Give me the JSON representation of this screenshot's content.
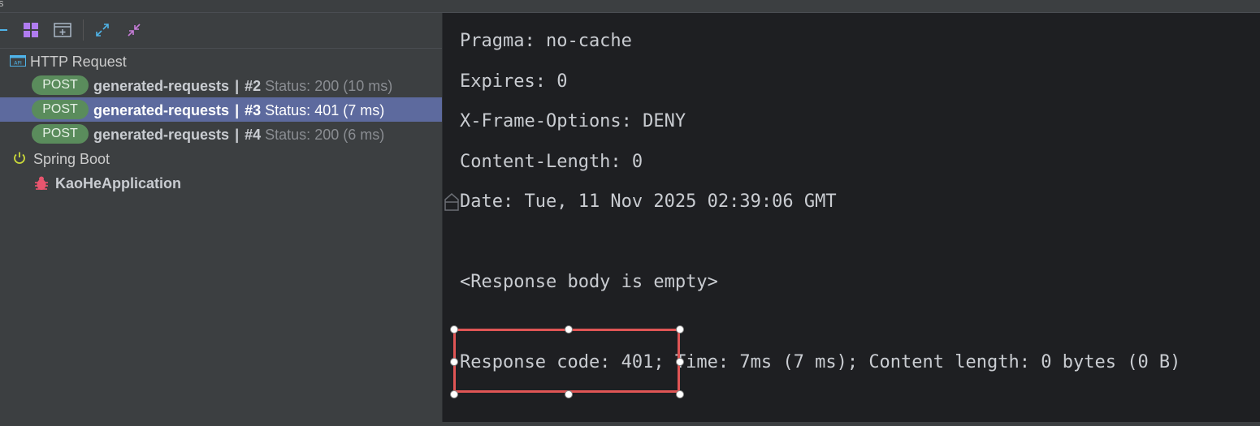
{
  "topbar": {
    "fragment": "s"
  },
  "toolbar": {
    "icons": [
      "minus-icon",
      "layout-grid-icon",
      "add-panel-icon",
      "expand-icon",
      "collapse-icon"
    ]
  },
  "tree": {
    "http_group": "HTTP Request",
    "requests": [
      {
        "method": "POST",
        "name": "generated-requests",
        "separator": "|",
        "number": "#2",
        "status": "Status: 200 (10 ms)"
      },
      {
        "method": "POST",
        "name": "generated-requests",
        "separator": "|",
        "number": "#3",
        "status": "Status: 401 (7 ms)"
      },
      {
        "method": "POST",
        "name": "generated-requests",
        "separator": "|",
        "number": "#4",
        "status": "Status: 200 (6 ms)"
      }
    ],
    "spring_group": "Spring Boot",
    "spring_app": "KaoHeApplication"
  },
  "response": {
    "headers": [
      "Pragma: no-cache",
      "Expires: 0",
      "X-Frame-Options: DENY",
      "Content-Length: 0",
      "Date: Tue, 11 Nov 2025 02:39:06 GMT"
    ],
    "body": "<Response body is empty>",
    "summary": "Response code: 401; Time: 7ms (7 ms); Content length: 0 bytes (0 B)"
  },
  "colors": {
    "selection": "#5d6a9e",
    "method_pill": "#5a8c5c",
    "annotation": "#e05555"
  }
}
